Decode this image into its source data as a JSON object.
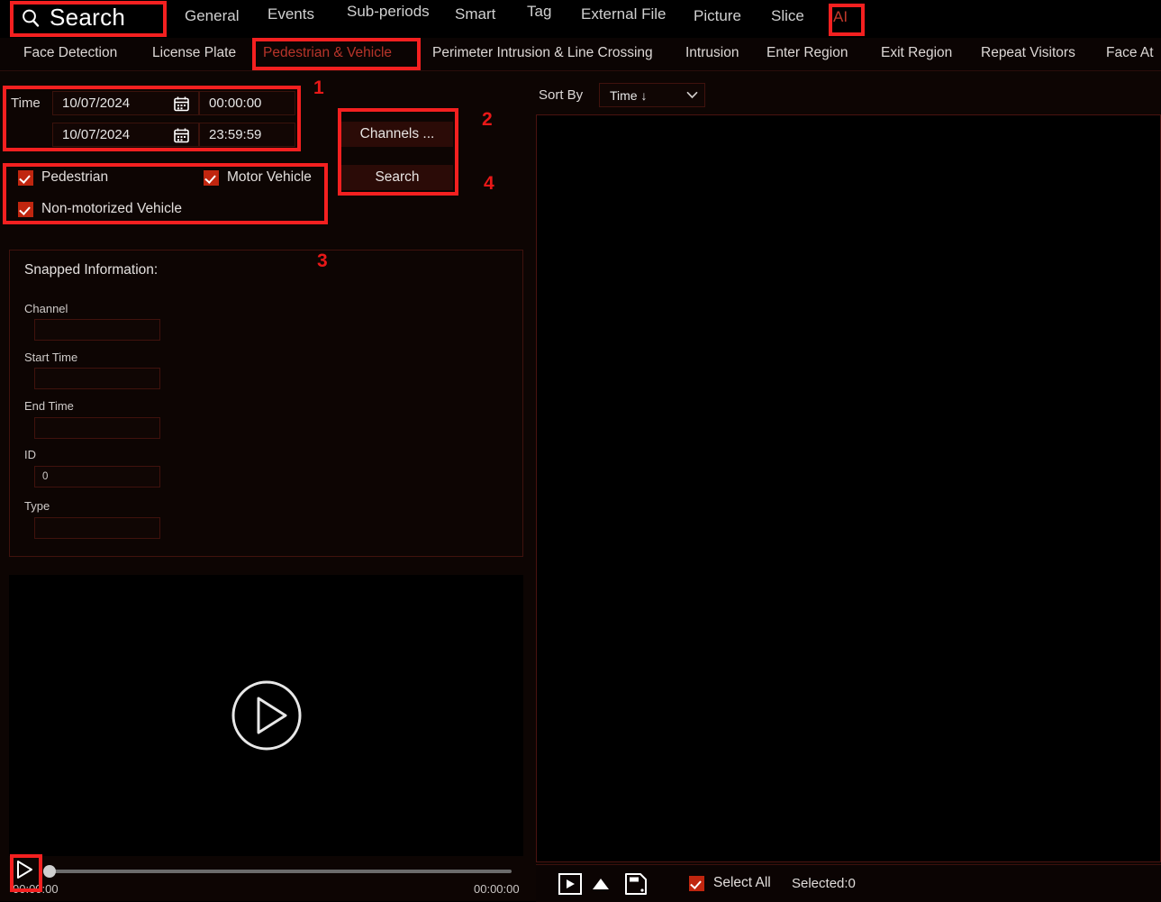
{
  "app": {
    "title": "Search",
    "search_icon": "magnifier-icon"
  },
  "top_menu": {
    "items": [
      {
        "label": "General",
        "active": false
      },
      {
        "label": "Events",
        "active": false
      },
      {
        "label": "Sub-periods",
        "active": false
      },
      {
        "label": "Smart",
        "active": false
      },
      {
        "label": "Tag",
        "active": false
      },
      {
        "label": "External File",
        "active": false
      },
      {
        "label": "Picture",
        "active": false
      },
      {
        "label": "Slice",
        "active": false
      },
      {
        "label": "AI",
        "active": true
      }
    ]
  },
  "sub_tabs": {
    "items": [
      {
        "label": "Face Detection",
        "active": false
      },
      {
        "label": "License Plate",
        "active": false
      },
      {
        "label": "Pedestrian & Vehicle",
        "active": true
      },
      {
        "label": "Perimeter Intrusion & Line Crossing",
        "active": false
      },
      {
        "label": "Intrusion",
        "active": false
      },
      {
        "label": "Enter Region",
        "active": false
      },
      {
        "label": "Exit Region",
        "active": false
      },
      {
        "label": "Repeat Visitors",
        "active": false
      },
      {
        "label": "Face At",
        "active": false
      }
    ]
  },
  "search_filters": {
    "time_label": "Time",
    "start_date": "10/07/2024",
    "start_time": "00:00:00",
    "end_date": "10/07/2024",
    "end_time": "23:59:59",
    "calendar_icon": "calendar-icon",
    "checkboxes": [
      {
        "label": "Pedestrian",
        "checked": true
      },
      {
        "label": "Motor Vehicle",
        "checked": true
      },
      {
        "label": "Non-motorized Vehicle",
        "checked": true
      }
    ],
    "channels_button": "Channels ...",
    "search_button": "Search"
  },
  "snapped_information": {
    "title": "Snapped Information:",
    "fields": [
      {
        "label": "Channel",
        "value": ""
      },
      {
        "label": "Start Time",
        "value": ""
      },
      {
        "label": "End Time",
        "value": ""
      },
      {
        "label": "ID",
        "value": "0"
      },
      {
        "label": "Type",
        "value": ""
      }
    ]
  },
  "player": {
    "play_icon": "play-triangle-icon",
    "preview_play_icon": "play-circle-icon",
    "current_time": "00:00:00",
    "total_time": "00:00:00"
  },
  "results_panel": {
    "sort_by_label": "Sort By",
    "sort_by_value": "Time ↓",
    "chevron_icon": "chevron-down-icon",
    "toolbar_icons": [
      {
        "name": "play-box-icon"
      },
      {
        "name": "up-arrow-icon"
      },
      {
        "name": "save-file-icon"
      }
    ],
    "select_all_label": "Select All",
    "select_all_checked": true,
    "selected_count_label": "Selected:0"
  },
  "annotations": {
    "numbers": [
      "1",
      "2",
      "3",
      "4"
    ],
    "highlight_color": "#f42020"
  }
}
